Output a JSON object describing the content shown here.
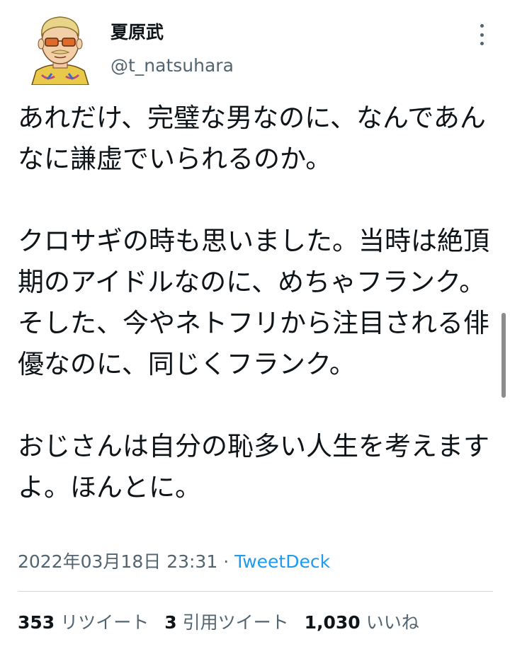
{
  "author": {
    "display_name": "夏原武",
    "handle": "@t_natsuhara",
    "avatar_icon": "cartoon-avatar-icon"
  },
  "more_icon": "more-vertical-icon",
  "tweet": {
    "paragraphs": [
      "あれだけ、完璧な男なのに、なんであんなに謙虚でいられるのか。",
      "クロサギの時も思いました。当時は絶頂期のアイドルなのに、めちゃフランク。そした、今やネトフリから注目される俳優なのに、同じくフランク。",
      "おじさんは自分の恥多い人生を考えますよ。ほんとに。"
    ]
  },
  "meta": {
    "timestamp": "2022年03月18日 23:31",
    "separator": " · ",
    "source": "TweetDeck"
  },
  "stats": {
    "retweets": {
      "count": "353",
      "label": "リツイート"
    },
    "quotes": {
      "count": "3",
      "label": "引用ツイート"
    },
    "likes": {
      "count": "1,030",
      "label": "いいね"
    }
  },
  "colors": {
    "text": "#0f1419",
    "secondary": "#536471",
    "link": "#1d9bf0",
    "divider": "#cfd9de"
  }
}
